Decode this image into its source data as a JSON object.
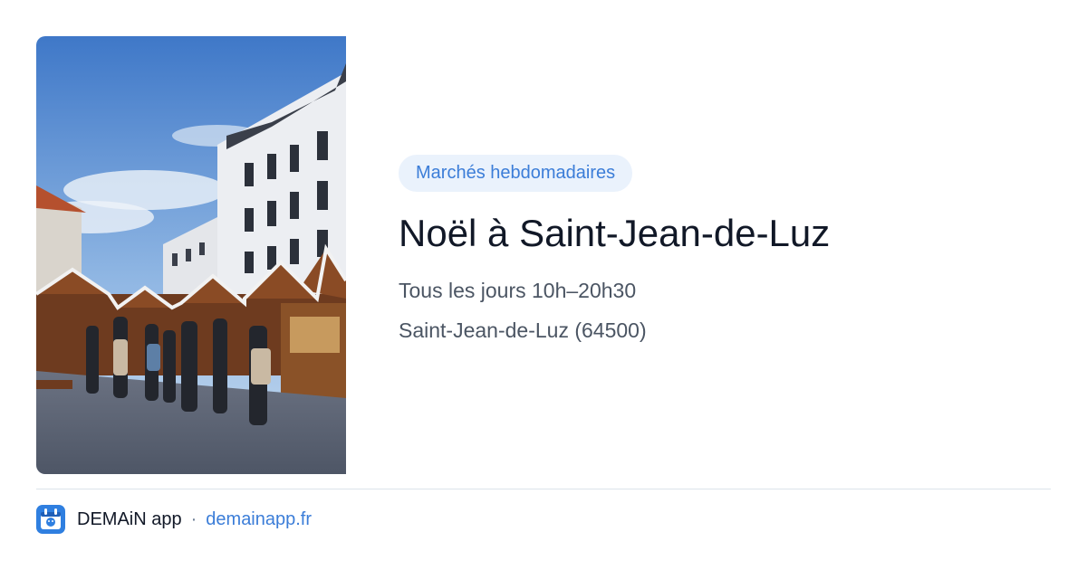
{
  "card": {
    "category": "Marchés hebdomadaires",
    "title": "Noël à Saint-Jean-de-Luz",
    "hours": "Tous les jours 10h–20h30",
    "location": "Saint-Jean-de-Luz (64500)"
  },
  "image": {
    "subject": "christmas-market-photo"
  },
  "footer": {
    "app_name": "DEMAiN app",
    "separator": "·",
    "domain": "demainapp.fr",
    "app_icon": "demain-app-icon"
  },
  "colors": {
    "accent": "#3b7dd8",
    "badge_background": "#eaf2fc",
    "title_text": "#111827",
    "secondary_text": "#4b5563",
    "divider": "#dbe3ea"
  }
}
